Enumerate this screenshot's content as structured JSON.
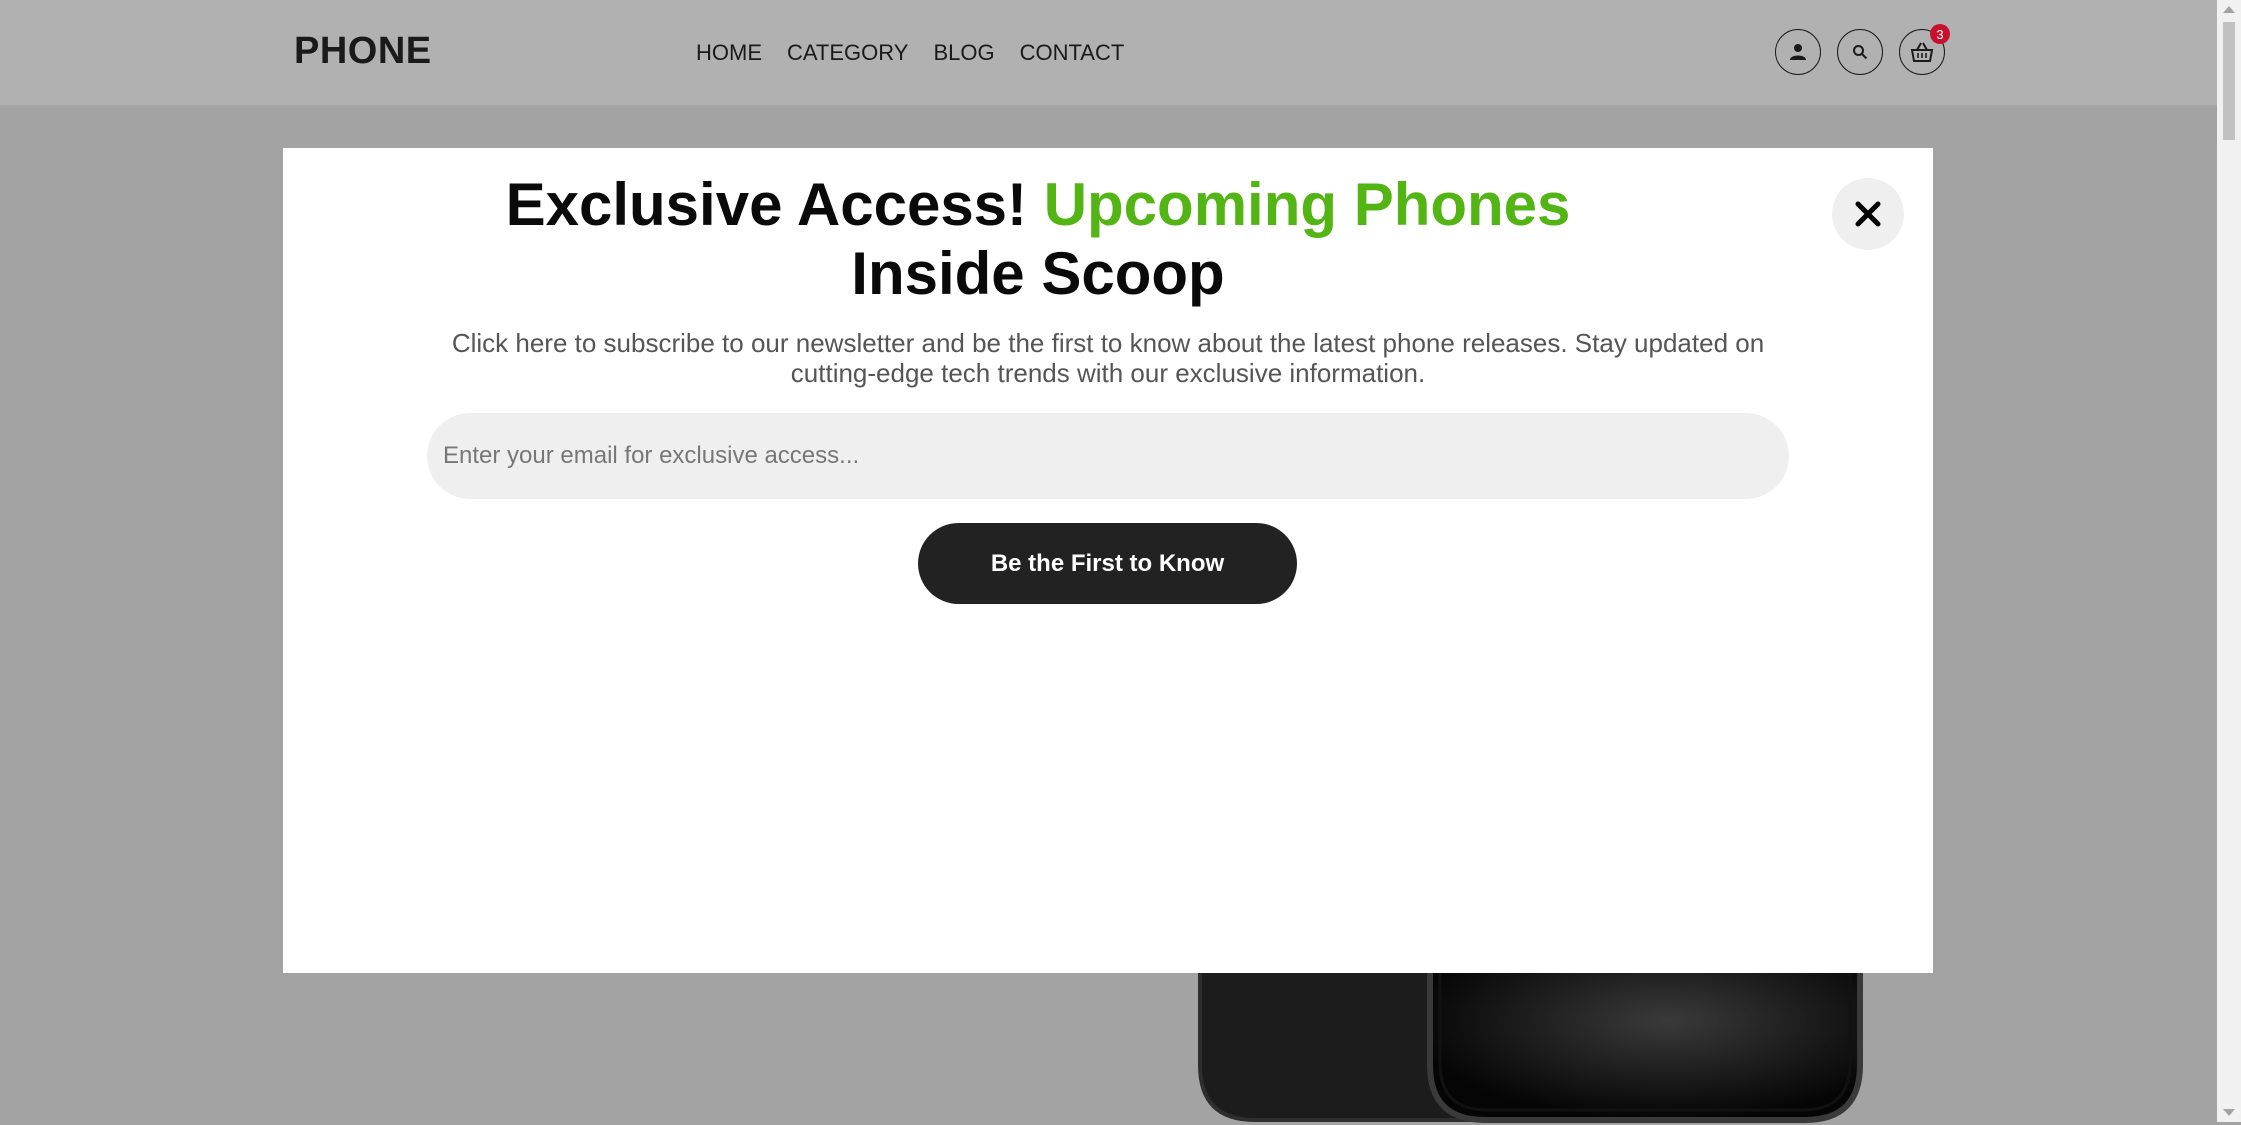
{
  "header": {
    "logo": "PHONE",
    "nav": [
      "HOME",
      "CATEGORY",
      "BLOG",
      "CONTACT"
    ],
    "cart_count": "3",
    "icons": [
      "user-icon",
      "search-icon",
      "cart-basket-icon"
    ]
  },
  "modal": {
    "title_part1": "Exclusive Access! ",
    "title_accent": "Upcoming Phones",
    "title_part2": " Inside Scoop",
    "description": "Click here to subscribe to our newsletter and be the first to know about the latest phone releases. Stay updated on cutting-edge tech trends with our exclusive information.",
    "email_placeholder": "Enter your email for exclusive access...",
    "cta_label": "Be the First to Know",
    "accent_color": "#52b513"
  }
}
